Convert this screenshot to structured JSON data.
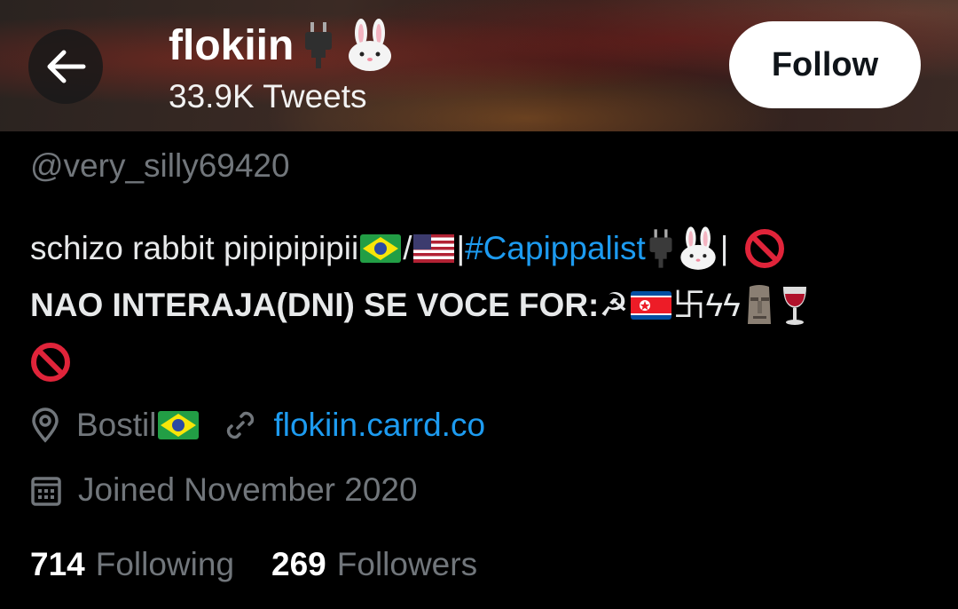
{
  "header": {
    "display_name": "flokiin",
    "name_emojis": [
      "plug-icon",
      "rabbit-face-icon"
    ],
    "tweet_count": "33.9K Tweets",
    "follow_label": "Follow"
  },
  "profile": {
    "handle": "@very_silly69420",
    "bio_line1_text": "schizo rabbit pipipipipii ",
    "bio_line1_sep1": "/",
    "bio_line1_sep2": "|",
    "bio_hashtag": "#Capippalist",
    "bio_line1_sep3": "|",
    "bio_line2_text": "NAO INTERAJA(DNI) SE VOCE FOR: ",
    "bio_line2_symbols": "☭",
    "bio_line2_symbols2": "卐ϟϟ",
    "location": "Bostil",
    "website": "flokiin.carrd.co",
    "joined": "Joined November 2020"
  },
  "stats": {
    "following_count": "714",
    "following_label": "Following",
    "followers_count": "269",
    "followers_label": "Followers"
  },
  "colors": {
    "background": "#000000",
    "text_primary": "#e7e9ea",
    "text_secondary": "#71767b",
    "link": "#1d9bf0",
    "follow_button_bg": "#ffffff"
  }
}
